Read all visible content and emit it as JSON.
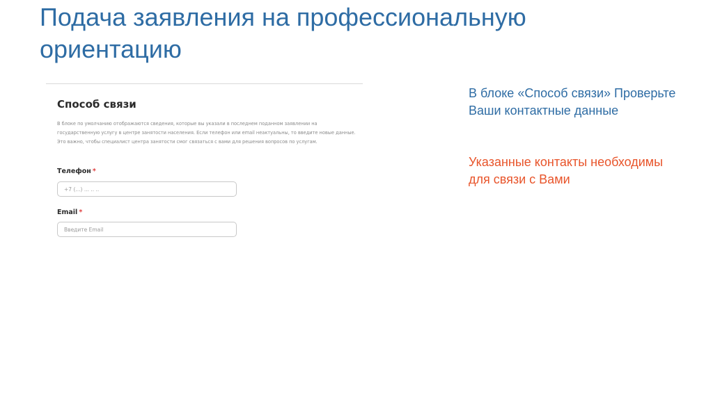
{
  "slide": {
    "title": "Подача заявления на профессиональную ориентацию"
  },
  "form": {
    "section_title": "Способ связи",
    "description": "В блоке по умолчанию отображаются сведения, которые вы указали в последнем поданном заявлении на государственную услугу в центре занятости населения. Если телефон или email неактуальны, то введите новые данные. Это важно, чтобы специалист центра занятости смог связаться с вами для решения вопросов по услугам.",
    "phone": {
      "label": "Телефон",
      "required_mark": "*",
      "placeholder": "+7 (...) ... .. .."
    },
    "email": {
      "label": "Email",
      "required_mark": "*",
      "placeholder": "Введите Email"
    }
  },
  "side_note": {
    "info": "В блоке «Способ связи» Проверьте Ваши контактные данные",
    "warning": "Указанные контакты необходимы для связи с Вами"
  },
  "colors": {
    "title": "#2e6ca4",
    "info_text": "#2e6ca4",
    "warning_text": "#e8542a",
    "required_mark": "#e04040"
  }
}
